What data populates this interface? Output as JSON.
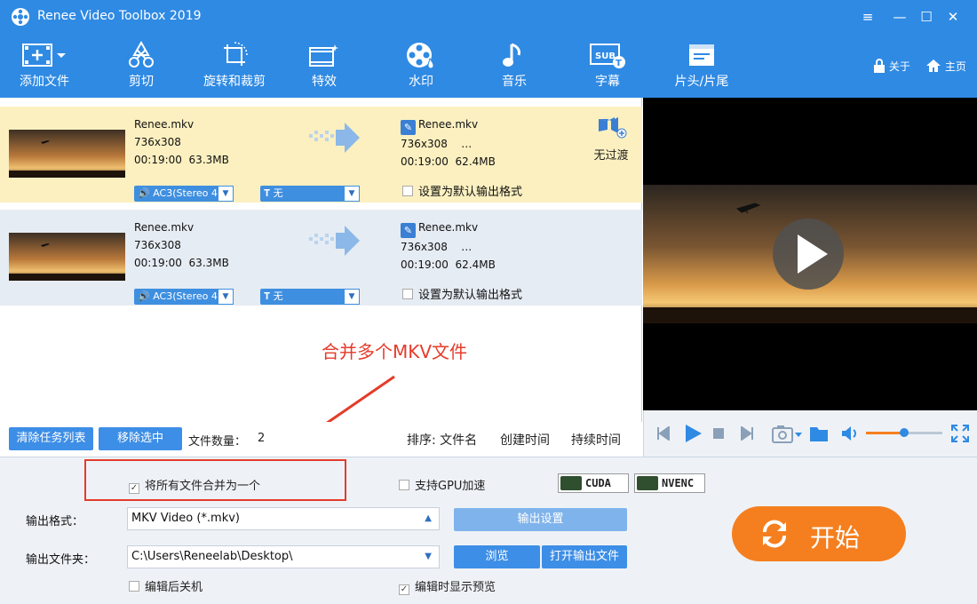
{
  "window": {
    "title": "Renee Video Toolbox 2019",
    "controls": {
      "menu": "≡",
      "minimize": "—",
      "maximize": "☐",
      "close": "✕"
    }
  },
  "toolbar": {
    "items": [
      {
        "label": "添加文件",
        "icon": "add-file-icon"
      },
      {
        "label": "剪切",
        "icon": "cut-icon"
      },
      {
        "label": "旋转和裁剪",
        "icon": "rotate-crop-icon"
      },
      {
        "label": "特效",
        "icon": "effects-icon"
      },
      {
        "label": "水印",
        "icon": "watermark-icon"
      },
      {
        "label": "音乐",
        "icon": "music-icon"
      },
      {
        "label": "字幕",
        "icon": "subtitle-icon"
      },
      {
        "label": "片头/片尾",
        "icon": "intro-outro-icon"
      }
    ],
    "about": "关于",
    "home": "主页"
  },
  "files": [
    {
      "src_name": "Renee.mkv",
      "src_res": "736x308",
      "src_duration": "00:19:00",
      "src_size": "63.3MB",
      "dst_name": "Renee.mkv",
      "dst_res": "736x308",
      "dst_more": "…",
      "dst_duration": "00:19:00",
      "dst_size": "62.4MB",
      "audio": "AC3(Stereo 4",
      "subtitle": "无",
      "default_format_label": "设置为默认输出格式",
      "transition_label": "无过渡"
    },
    {
      "src_name": "Renee.mkv",
      "src_res": "736x308",
      "src_duration": "00:19:00",
      "src_size": "63.3MB",
      "dst_name": "Renee.mkv",
      "dst_res": "736x308",
      "dst_more": "…",
      "dst_duration": "00:19:00",
      "dst_size": "62.4MB",
      "audio": "AC3(Stereo 4",
      "subtitle": "无",
      "default_format_label": "设置为默认输出格式"
    }
  ],
  "annotation": "合并多个MKV文件",
  "list_bar": {
    "clear_label": "清除任务列表",
    "remove_label": "移除选中",
    "count_label": "文件数量：",
    "count_value": "2",
    "sort_label": "排序: 文件名",
    "sort_created": "创建时间",
    "sort_duration": "持续时间"
  },
  "options": {
    "merge_label": "将所有文件合并为一个",
    "merge_checked": true,
    "gpu_label": "支持GPU加速",
    "gpu_checked": false,
    "cuda_label": "CUDA",
    "nvenc_label": "NVENC",
    "shutdown_label": "编辑后关机",
    "shutdown_checked": false,
    "preview_label": "编辑时显示预览",
    "preview_checked": true
  },
  "output": {
    "format_label": "输出格式：",
    "format_value": "MKV Video (*.mkv)",
    "settings_label": "输出设置",
    "folder_label": "输出文件夹：",
    "folder_value": "C:\\Users\\Reneelab\\Desktop\\",
    "browse_label": "浏览",
    "open_label": "打开输出文件"
  },
  "start_label": "开始",
  "colors": {
    "accent": "#2f8ae3",
    "start": "#f57f1e",
    "annotation": "#e53b2a",
    "selected_row": "#fcf0c0"
  }
}
